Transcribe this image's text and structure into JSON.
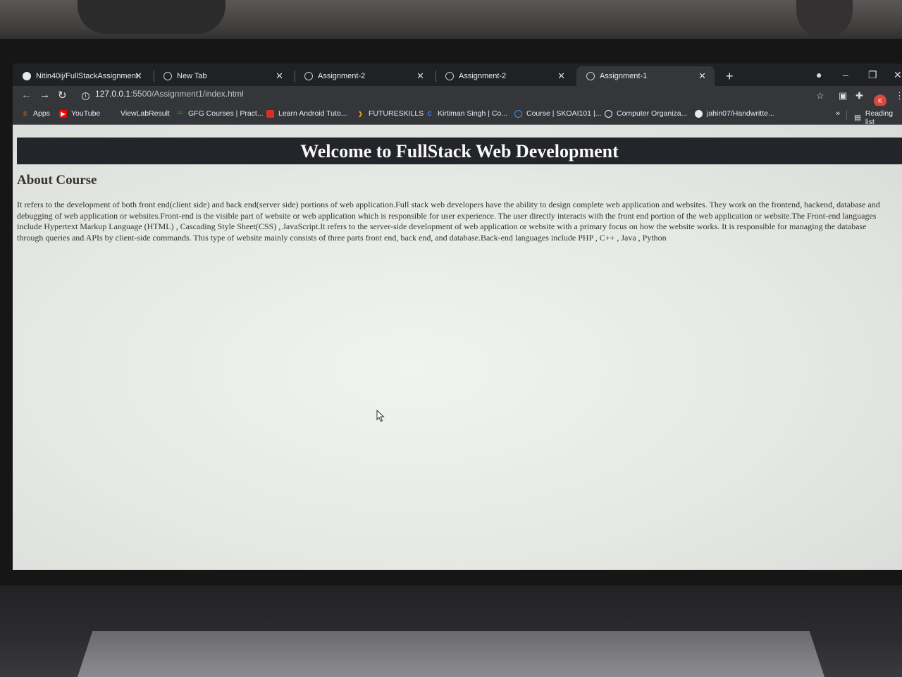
{
  "browser": {
    "tabs": [
      {
        "title": "Nitin40ij/FullStackAssignment",
        "favicon": "github-icon",
        "active": false
      },
      {
        "title": "New Tab",
        "favicon": "globe-icon",
        "active": false
      },
      {
        "title": "Assignment-2",
        "favicon": "globe-icon",
        "active": false
      },
      {
        "title": "Assignment-2",
        "favicon": "globe-icon",
        "active": false
      },
      {
        "title": "Assignment-1",
        "favicon": "globe-icon",
        "active": true
      }
    ],
    "close_glyph": "✕",
    "new_tab_glyph": "+",
    "address": {
      "host": "127.0.0.1",
      "path": ":5500/Assignment1/index.html"
    },
    "profile_initial": "K",
    "bookmarks": [
      {
        "label": "Apps",
        "icon": "apps-grid-icon",
        "color": "#e8710a"
      },
      {
        "label": "YouTube",
        "icon": "youtube-icon",
        "color": "#ff0000"
      },
      {
        "label": "ViewLabResult",
        "icon": "none",
        "color": ""
      },
      {
        "label": "GFG Courses | Pract...",
        "icon": "gfg-icon",
        "color": "#2f8d46"
      },
      {
        "label": "Learn Android Tuto...",
        "icon": "bookmark-icon",
        "color": "#d93025"
      },
      {
        "label": "FUTURESKILLS",
        "icon": "chevron-right-icon",
        "color": "#f5a623"
      },
      {
        "label": "Kirtiman Singh | Co...",
        "icon": "c-logo-icon",
        "color": "#4285f4"
      },
      {
        "label": "Course | SKOAI101 |...",
        "icon": "globe-icon",
        "color": "#4a90d9"
      },
      {
        "label": "Computer Organiza...",
        "icon": "globe-icon",
        "color": "#e8eaed"
      },
      {
        "label": "jahin07/Handwritte...",
        "icon": "github-icon",
        "color": "#e8eaed"
      }
    ],
    "reading_list": "Reading list"
  },
  "page": {
    "heading": "Welcome to FullStack Web Development",
    "section_title": "About Course",
    "description": "It refers to the development of both front end(client side) and back end(server side) portions of web application.Full stack web developers have the ability to design complete web application and websites. They work on the frontend, backend, database and debugging of web application or websites.Front-end is the visible part of website or web application which is responsible for user experience. The user directly interacts with the front end portion of the web application or website.The Front-end languages include Hypertext Markup Language (HTML) , Cascading Style Sheet(CSS) , JavaScript.It refers to the server-side development of web application or website with a primary focus on how the website works. It is responsible for managing the database through queries and APIs by client-side commands. This type of website mainly consists of three parts front end, back end, and database.Back-end languages include PHP , C++ , Java , Python"
  }
}
